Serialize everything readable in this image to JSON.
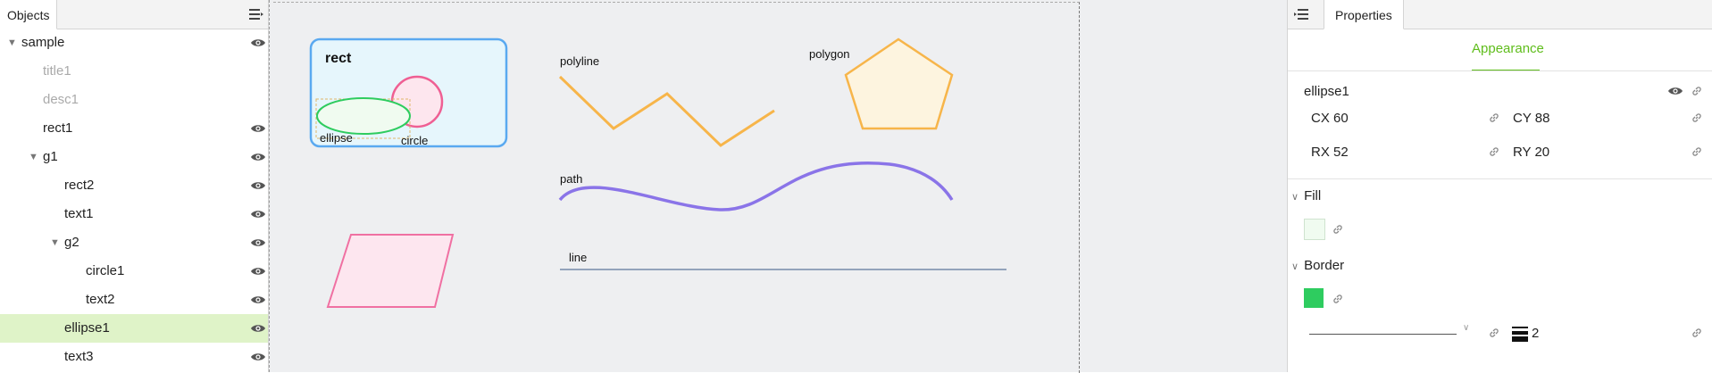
{
  "left_panel": {
    "tab_label": "Objects",
    "tree": [
      {
        "label": "sample",
        "indent": 0,
        "caret": "▼",
        "visible": true,
        "dim": false,
        "selected": false
      },
      {
        "label": "title1",
        "indent": 1,
        "caret": "",
        "visible": false,
        "dim": true,
        "selected": false
      },
      {
        "label": "desc1",
        "indent": 1,
        "caret": "",
        "visible": false,
        "dim": true,
        "selected": false
      },
      {
        "label": "rect1",
        "indent": 1,
        "caret": "",
        "visible": true,
        "dim": false,
        "selected": false
      },
      {
        "label": "g1",
        "indent": 1,
        "caret": "▼",
        "visible": true,
        "dim": false,
        "selected": false
      },
      {
        "label": "rect2",
        "indent": 2,
        "caret": "",
        "visible": true,
        "dim": false,
        "selected": false
      },
      {
        "label": "text1",
        "indent": 2,
        "caret": "",
        "visible": true,
        "dim": false,
        "selected": false
      },
      {
        "label": "g2",
        "indent": 2,
        "caret": "▼",
        "visible": true,
        "dim": false,
        "selected": false
      },
      {
        "label": "circle1",
        "indent": 3,
        "caret": "",
        "visible": true,
        "dim": false,
        "selected": false
      },
      {
        "label": "text2",
        "indent": 3,
        "caret": "",
        "visible": true,
        "dim": false,
        "selected": false
      },
      {
        "label": "ellipse1",
        "indent": 2,
        "caret": "",
        "visible": true,
        "dim": false,
        "selected": true
      },
      {
        "label": "text3",
        "indent": 2,
        "caret": "",
        "visible": true,
        "dim": false,
        "selected": false
      }
    ]
  },
  "canvas": {
    "labels": {
      "rect": "rect",
      "ellipse": "ellipse",
      "circle": "circle",
      "polyline": "polyline",
      "polygon": "polygon",
      "path": "path",
      "line": "line"
    }
  },
  "properties": {
    "tab_label": "Properties",
    "section_tab": "Appearance",
    "object_name": "ellipse1",
    "fields": [
      {
        "label": "CX",
        "value": "60"
      },
      {
        "label": "CY",
        "value": "88"
      },
      {
        "label": "RX",
        "value": "52"
      },
      {
        "label": "RY",
        "value": "20"
      }
    ],
    "fill_label": "Fill",
    "fill_color": "#f0fbf0",
    "border_label": "Border",
    "border_color": "#2ecc5f",
    "stroke_width": "2"
  },
  "colors": {
    "accent": "#5fbd1b",
    "selection": "#dff3c8",
    "rect_stroke": "#5aa9f0",
    "rect_fill": "#e6f6fc",
    "circle_stroke": "#ef5f93",
    "ellipse_stroke": "#2ecc5f",
    "orange": "#f7b54a",
    "purple": "#8a74e8",
    "pink": "#f070a2",
    "line": "#93a3bb"
  }
}
